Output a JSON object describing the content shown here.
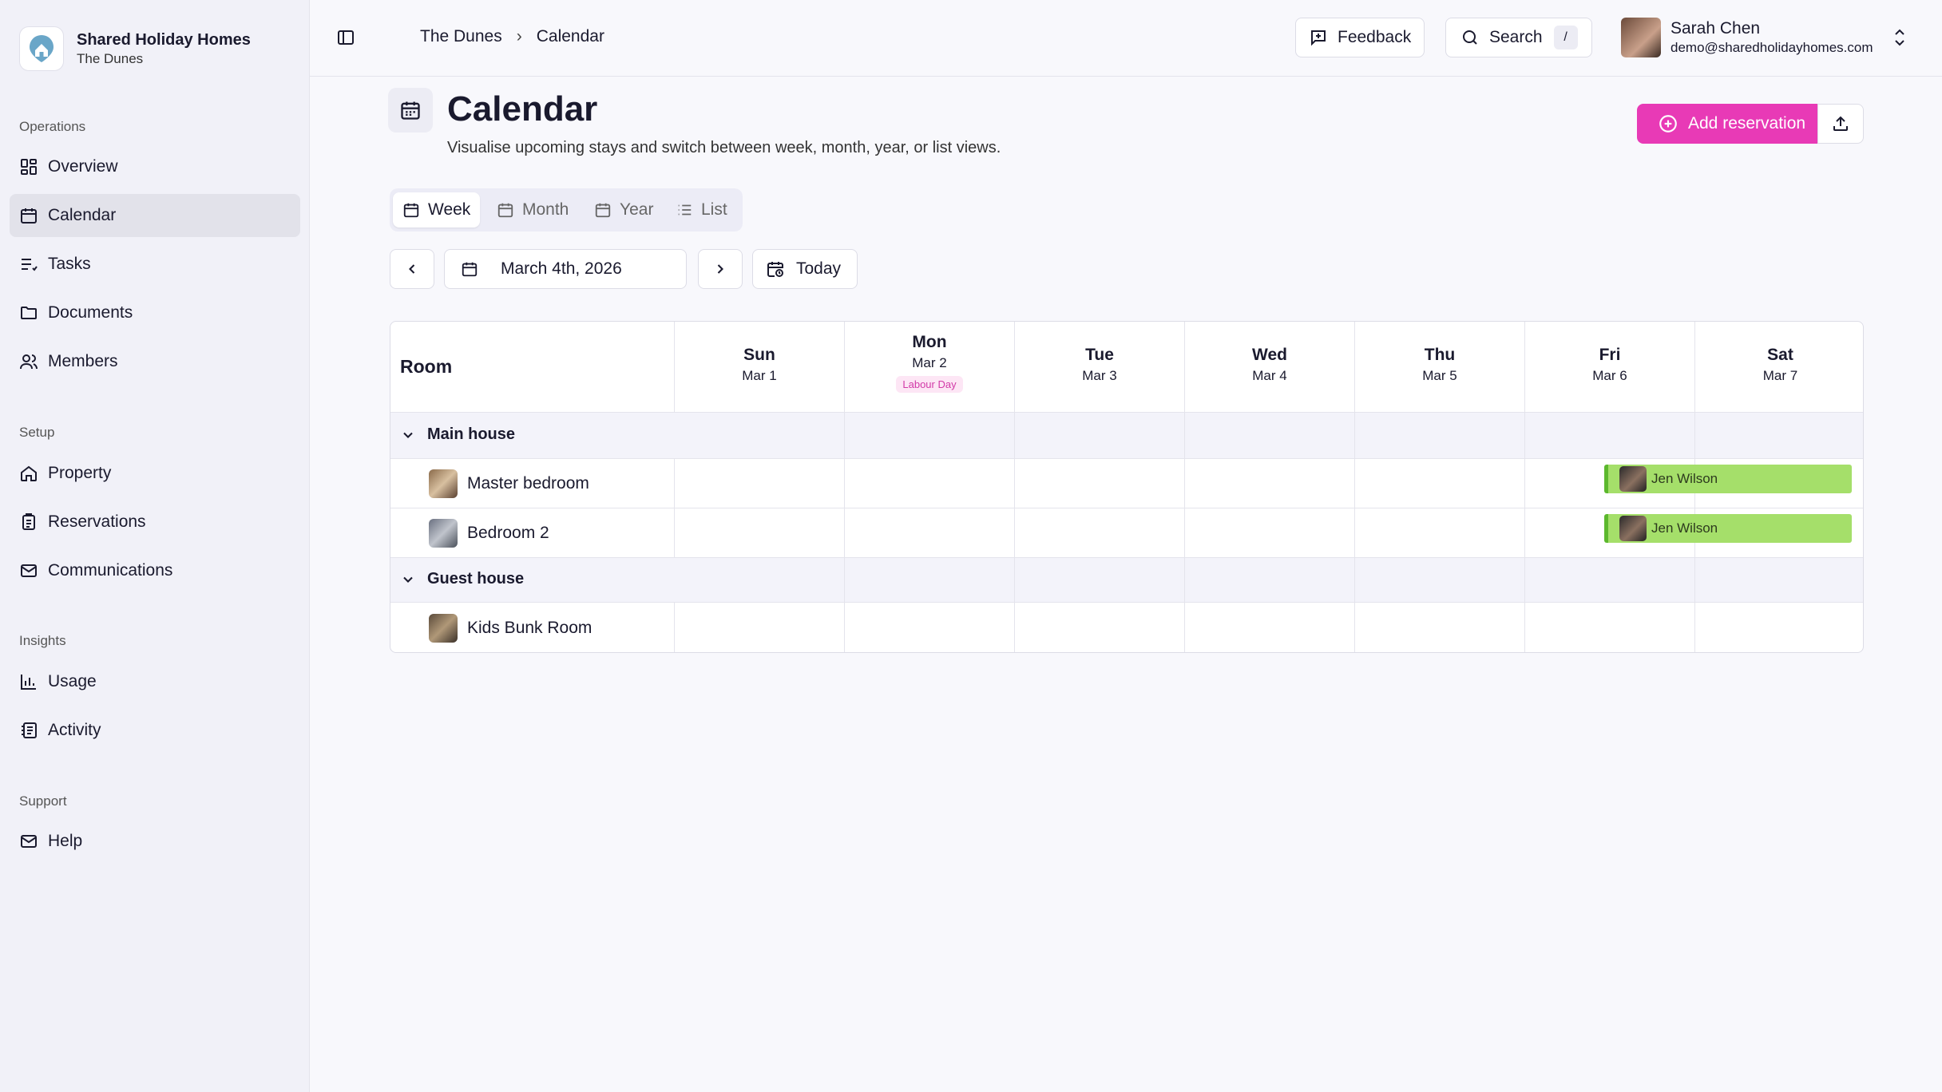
{
  "app": {
    "name": "Shared Holiday Homes",
    "property": "The Dunes"
  },
  "sidebar": {
    "sections": [
      {
        "title": "Operations",
        "items": [
          {
            "label": "Overview"
          },
          {
            "label": "Calendar"
          },
          {
            "label": "Tasks"
          },
          {
            "label": "Documents"
          },
          {
            "label": "Members"
          }
        ]
      },
      {
        "title": "Setup",
        "items": [
          {
            "label": "Property"
          },
          {
            "label": "Reservations"
          },
          {
            "label": "Communications"
          }
        ]
      },
      {
        "title": "Insights",
        "items": [
          {
            "label": "Usage"
          },
          {
            "label": "Activity"
          }
        ]
      },
      {
        "title": "Support",
        "items": [
          {
            "label": "Help"
          }
        ]
      }
    ]
  },
  "breadcrumb": [
    "The Dunes",
    "Calendar"
  ],
  "header": {
    "feedback_label": "Feedback",
    "search_label": "Search",
    "search_shortcut": "/"
  },
  "user": {
    "name": "Sarah Chen",
    "email": "demo@sharedholidayhomes.com"
  },
  "page": {
    "title": "Calendar",
    "subtitle": "Visualise upcoming stays and switch between week, month, year, or list views.",
    "add_label": "Add reservation"
  },
  "views": {
    "active": "Week",
    "items": [
      "Week",
      "Month",
      "Year",
      "List"
    ]
  },
  "date_nav": {
    "current": "March 4th, 2026",
    "today_label": "Today"
  },
  "calendar": {
    "room_header": "Room",
    "days": [
      {
        "name": "Sun",
        "date": "Mar 1"
      },
      {
        "name": "Mon",
        "date": "Mar 2",
        "holiday": "Labour Day"
      },
      {
        "name": "Tue",
        "date": "Mar 3"
      },
      {
        "name": "Wed",
        "date": "Mar 4"
      },
      {
        "name": "Thu",
        "date": "Mar 5"
      },
      {
        "name": "Fri",
        "date": "Mar 6"
      },
      {
        "name": "Sat",
        "date": "Mar 7"
      }
    ],
    "groups": [
      {
        "name": "Main house",
        "rooms": [
          {
            "name": "Master bedroom",
            "booking": {
              "guest": "Jen Wilson",
              "start_day": "Fri",
              "end_day": "Sat"
            }
          },
          {
            "name": "Bedroom 2",
            "booking": {
              "guest": "Jen Wilson",
              "start_day": "Fri",
              "end_day": "Sat"
            }
          }
        ]
      },
      {
        "name": "Guest house",
        "rooms": [
          {
            "name": "Kids Bunk Room"
          }
        ]
      }
    ]
  },
  "colors": {
    "accent": "#e83ab6",
    "booking": "#a5df6a",
    "booking_edge": "#5cb82d"
  }
}
